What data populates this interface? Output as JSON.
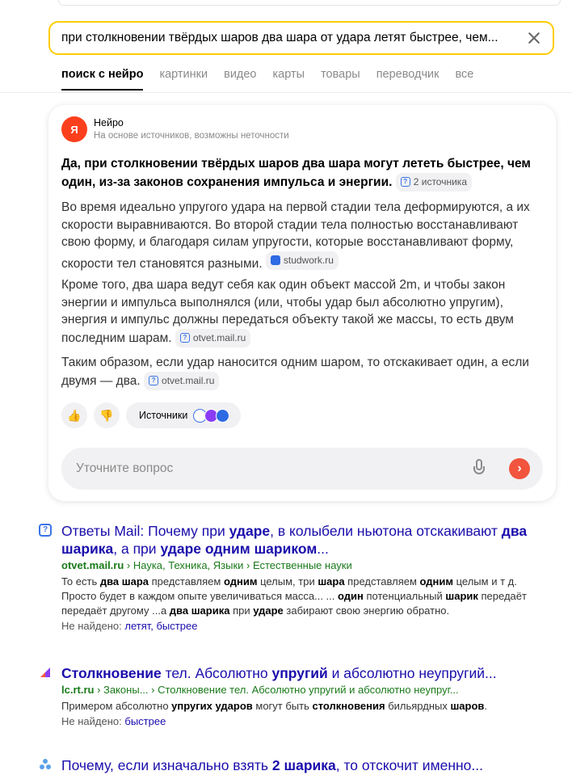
{
  "search": {
    "query": "при столкновении твёрдых шаров два шара от удара летят быстрее, чем..."
  },
  "tabs": [
    "поиск с нейро",
    "картинки",
    "видео",
    "карты",
    "товары",
    "переводчик",
    "все"
  ],
  "neuro": {
    "logo": "Я",
    "name": "Нейро",
    "subtitle": "На основе источников, возможны неточности",
    "summary": "Да, при столкновении твёрдых шаров два шара могут лететь быстрее, чем один, из-за законов сохранения импульса и энергии.",
    "summary_chip": "2 источника",
    "p1": "Во время идеально упругого удара на первой стадии тела деформируются, а их скорости выравниваются. Во второй стадии тела полностью восстанавливают свою форму, и благодаря силам упругости, которые восстанавливают форму, скорости тел становятся разными.",
    "p1_chip": "studwork.ru",
    "p2": "Кроме того, два шара ведут себя как один объект массой 2m, и чтобы закон энергии и импульса выполнялся (или, чтобы удар был абсолютно упругим), энергия и импульс должны передаться объекту такой же массы, то есть двум последним шарам.",
    "p2_chip": "otvet.mail.ru",
    "p3": "Таким образом, если удар наносится одним шаром, то отскакивает один, а если двумя — два.",
    "p3_chip": "otvet.mail.ru",
    "sources_label": "Источники",
    "ask_placeholder": "Уточните вопрос"
  },
  "results": [
    {
      "title_parts": [
        "Ответы Mail: Почему при ",
        "ударе",
        ", в колыбели ньютона отскакивают ",
        "два шарика",
        ", а при ",
        "ударе одним шариком",
        "..."
      ],
      "url_site": "otvet.mail.ru",
      "url_path": " › Наука, Техника, Языки › Естественные науки",
      "snippet_parts": [
        "То есть ",
        "два шара",
        " представляем ",
        "одним",
        " целым, три ",
        "шара",
        " представляем ",
        "одним",
        " целым и т д. Просто будет в каждом опыте увеличиваться масса... ... ",
        "один",
        " потенциальный ",
        "шарик",
        " передаёт передаёт другому ...а ",
        "два шарика",
        " при ",
        "ударе",
        " забирают свою энергию обратно."
      ],
      "not_found_label": "Не найдено:",
      "not_found_words": "летят, быстрее"
    },
    {
      "title_parts": [
        "Столкновение",
        " тел. Абсолютно ",
        "упругий",
        " и абсолютно неупругий..."
      ],
      "url_site": "lc.rt.ru",
      "url_path": " › Законы... › Столкновение тел. Абсолютно упругий и абсолютно неупруг...",
      "snippet_parts": [
        "Примером абсолютно ",
        "упругих ударов",
        " могут быть ",
        "столкновения",
        " бильярдных ",
        "шаров",
        "."
      ],
      "not_found_label": "Не найдено:",
      "not_found_words": "быстрее"
    },
    {
      "title_parts": [
        "Почему, если изначально взять ",
        "2 шарика",
        ", то отскочит именно..."
      ]
    }
  ],
  "colors": {
    "accent_yellow": "#ffcc00",
    "link": "#1a0dab",
    "url_green": "#1a7a1a",
    "send_red": "#f2543d"
  }
}
